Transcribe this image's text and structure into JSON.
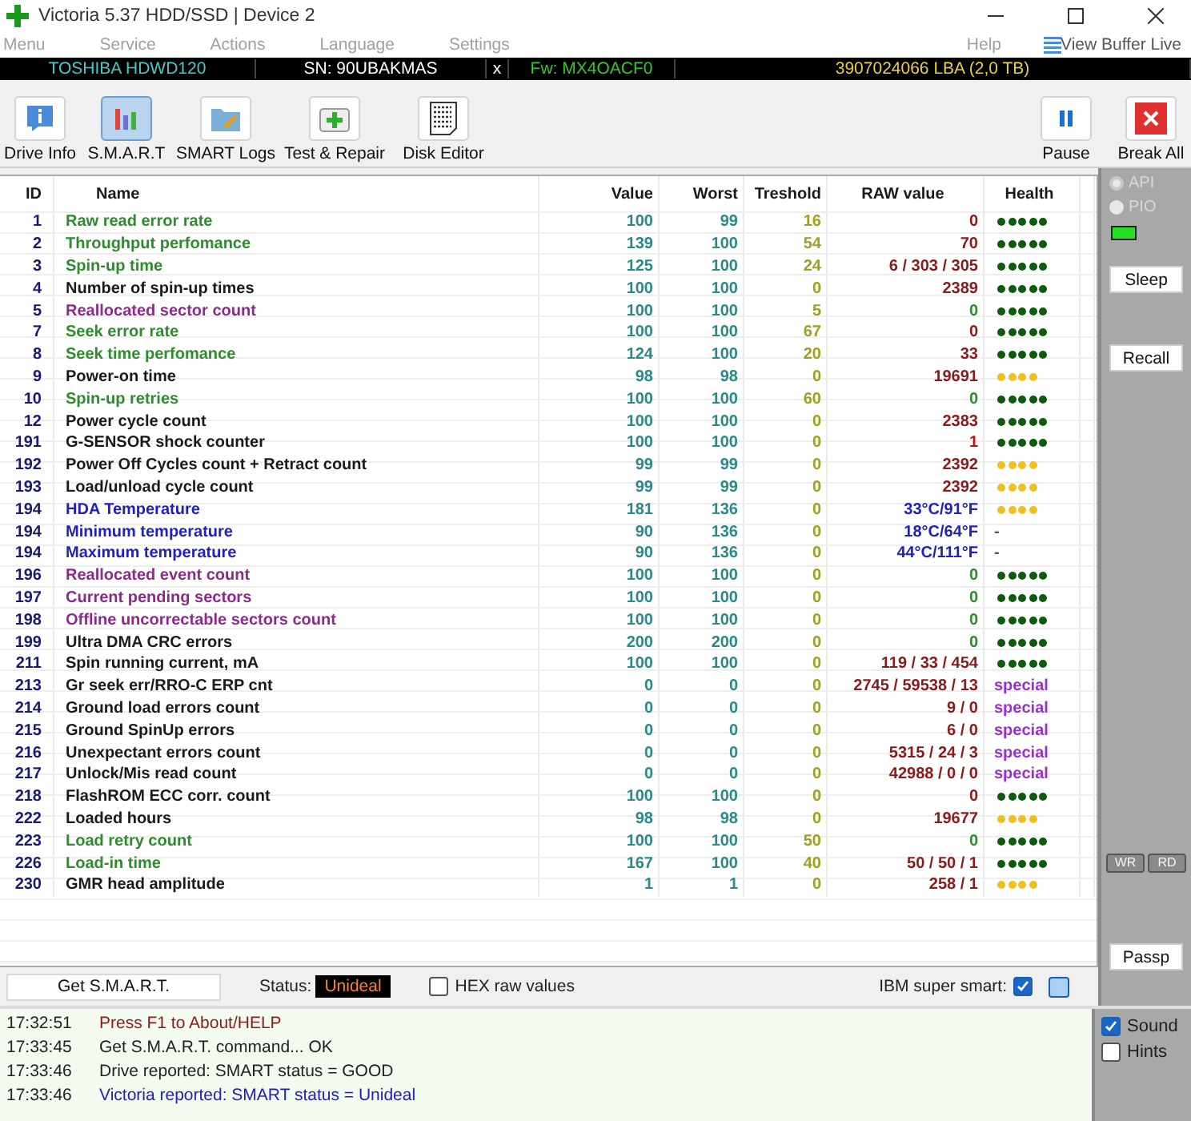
{
  "window": {
    "title": "Victoria 5.37 HDD/SSD | Device 2"
  },
  "menu": [
    {
      "label": "Menu"
    },
    {
      "label": "Service"
    },
    {
      "label": "Actions"
    },
    {
      "label": "Language"
    },
    {
      "label": "Settings"
    }
  ],
  "menu_right": [
    {
      "label": "Help"
    },
    {
      "label": "View Buffer Live"
    }
  ],
  "drive_bar": {
    "model": "TOSHIBA HDWD120",
    "serial": "SN: 90UBAKMAS",
    "close": "x",
    "firmware": "Fw: MX4OACF0",
    "capacity": "3907024066 LBA (2,0 TB)"
  },
  "toolbar": [
    {
      "label": "Drive Info",
      "kind": "info",
      "selected": false
    },
    {
      "label": "S.M.A.R.T",
      "kind": "smart",
      "selected": true
    },
    {
      "label": "SMART Logs",
      "kind": "logs",
      "selected": false
    },
    {
      "label": "Test & Repair",
      "kind": "repair",
      "selected": false
    },
    {
      "label": "Disk Editor",
      "kind": "editor",
      "selected": false
    }
  ],
  "toolbar_right": [
    {
      "label": "Pause",
      "kind": "pause"
    },
    {
      "label": "Break All",
      "kind": "break"
    }
  ],
  "table": {
    "columns": [
      "ID",
      "Name",
      "Value",
      "Worst",
      "Treshold",
      "RAW value",
      "Health"
    ],
    "rows": [
      {
        "id": "1",
        "name": "Raw read error rate",
        "color": "#2e8b2e",
        "value": "100",
        "worst": "99",
        "threshold": "16",
        "raw": {
          "text": "0",
          "color": "#8b1a1a"
        },
        "health": {
          "kind": "dots",
          "stars": 5
        }
      },
      {
        "id": "2",
        "name": "Throughput perfomance",
        "color": "#2e8b2e",
        "value": "139",
        "worst": "100",
        "threshold": "54",
        "raw": {
          "text": "70",
          "color": "#8b1a1a"
        },
        "health": {
          "kind": "dots",
          "stars": 5
        }
      },
      {
        "id": "3",
        "name": "Spin-up time",
        "color": "#2e8b2e",
        "value": "125",
        "worst": "100",
        "threshold": "24",
        "raw": {
          "text": "6 / 303 / 305",
          "color": "#8b1a1a"
        },
        "health": {
          "kind": "dots",
          "stars": 5
        }
      },
      {
        "id": "4",
        "name": "Number of spin-up times",
        "color": "#1a1a1a",
        "value": "100",
        "worst": "100",
        "threshold": "0",
        "raw": {
          "text": "2389",
          "color": "#8b1a1a"
        },
        "health": {
          "kind": "dots",
          "stars": 5
        }
      },
      {
        "id": "5",
        "name": "Reallocated sector count",
        "color": "#8b2a8b",
        "value": "100",
        "worst": "100",
        "threshold": "5",
        "raw": {
          "text": "0",
          "color": "#2e8b2e"
        },
        "health": {
          "kind": "dots",
          "stars": 5
        }
      },
      {
        "id": "7",
        "name": "Seek error rate",
        "color": "#2e8b2e",
        "value": "100",
        "worst": "100",
        "threshold": "67",
        "raw": {
          "text": "0",
          "color": "#8b1a1a"
        },
        "health": {
          "kind": "dots",
          "stars": 5
        }
      },
      {
        "id": "8",
        "name": "Seek time perfomance",
        "color": "#2e8b2e",
        "value": "124",
        "worst": "100",
        "threshold": "20",
        "raw": {
          "text": "33",
          "color": "#8b1a1a"
        },
        "health": {
          "kind": "dots",
          "stars": 5
        }
      },
      {
        "id": "9",
        "name": "Power-on time",
        "color": "#1a1a1a",
        "value": "98",
        "worst": "98",
        "threshold": "0",
        "raw": {
          "text": "19691",
          "color": "#8b1a1a"
        },
        "health": {
          "kind": "dots",
          "stars": 4
        }
      },
      {
        "id": "10",
        "name": "Spin-up retries",
        "color": "#2e8b2e",
        "value": "100",
        "worst": "100",
        "threshold": "60",
        "raw": {
          "text": "0",
          "color": "#2e8b2e"
        },
        "health": {
          "kind": "dots",
          "stars": 5
        }
      },
      {
        "id": "12",
        "name": "Power cycle count",
        "color": "#1a1a1a",
        "value": "100",
        "worst": "100",
        "threshold": "0",
        "raw": {
          "text": "2383",
          "color": "#8b1a1a"
        },
        "health": {
          "kind": "dots",
          "stars": 5
        }
      },
      {
        "id": "191",
        "name": "G-SENSOR shock counter",
        "color": "#1a1a1a",
        "value": "100",
        "worst": "100",
        "threshold": "0",
        "raw": {
          "text": "1",
          "color": "#c01010"
        },
        "health": {
          "kind": "dots",
          "stars": 5
        }
      },
      {
        "id": "192",
        "name": "Power Off Cycles count + Retract count",
        "color": "#1a1a1a",
        "value": "99",
        "worst": "99",
        "threshold": "0",
        "raw": {
          "text": "2392",
          "color": "#8b1a1a"
        },
        "health": {
          "kind": "dots",
          "stars": 4
        }
      },
      {
        "id": "193",
        "name": "Load/unload cycle count",
        "color": "#1a1a1a",
        "value": "99",
        "worst": "99",
        "threshold": "0",
        "raw": {
          "text": "2392",
          "color": "#8b1a1a"
        },
        "health": {
          "kind": "dots",
          "stars": 4
        }
      },
      {
        "id": "194",
        "name": "HDA Temperature",
        "color": "#2020c0",
        "value": "181",
        "worst": "136",
        "threshold": "0",
        "raw": {
          "text": "33°C/91°F",
          "color": "#2020c0"
        },
        "health": {
          "kind": "dots",
          "stars": 4
        }
      },
      {
        "id": "194",
        "name": "Minimum temperature",
        "color": "#2020c0",
        "value": "90",
        "worst": "136",
        "threshold": "0",
        "raw": {
          "text": "18°C/64°F",
          "color": "#2020c0"
        },
        "health": {
          "kind": "label",
          "text": "-",
          "color": "#555555"
        }
      },
      {
        "id": "194",
        "name": "Maximum temperature",
        "color": "#2020c0",
        "value": "90",
        "worst": "136",
        "threshold": "0",
        "raw": {
          "text": "44°C/111°F",
          "color": "#2020c0"
        },
        "health": {
          "kind": "label",
          "text": "-",
          "color": "#555555"
        }
      },
      {
        "id": "196",
        "name": "Reallocated event count",
        "color": "#8b2a8b",
        "value": "100",
        "worst": "100",
        "threshold": "0",
        "raw": {
          "text": "0",
          "color": "#2e8b2e"
        },
        "health": {
          "kind": "dots",
          "stars": 5
        }
      },
      {
        "id": "197",
        "name": "Current pending sectors",
        "color": "#8b2a8b",
        "value": "100",
        "worst": "100",
        "threshold": "0",
        "raw": {
          "text": "0",
          "color": "#2e8b2e"
        },
        "health": {
          "kind": "dots",
          "stars": 5
        }
      },
      {
        "id": "198",
        "name": "Offline uncorrectable sectors count",
        "color": "#8b2a8b",
        "value": "100",
        "worst": "100",
        "threshold": "0",
        "raw": {
          "text": "0",
          "color": "#2e8b2e"
        },
        "health": {
          "kind": "dots",
          "stars": 5
        }
      },
      {
        "id": "199",
        "name": "Ultra DMA CRC errors",
        "color": "#1a1a1a",
        "value": "200",
        "worst": "200",
        "threshold": "0",
        "raw": {
          "text": "0",
          "color": "#2e8b2e"
        },
        "health": {
          "kind": "dots",
          "stars": 5
        }
      },
      {
        "id": "211",
        "name": "Spin running current, mA",
        "color": "#1a1a1a",
        "value": "100",
        "worst": "100",
        "threshold": "0",
        "raw": {
          "text": "119 / 33 / 454",
          "color": "#8b1a1a"
        },
        "health": {
          "kind": "dots",
          "stars": 5
        }
      },
      {
        "id": "213",
        "name": "Gr seek err/RRO-C ERP cnt",
        "color": "#1a1a1a",
        "value": "0",
        "worst": "0",
        "threshold": "0",
        "raw": {
          "text": "2745 / 59538 / 13",
          "color": "#8b1a1a"
        },
        "health": {
          "kind": "label",
          "text": "special",
          "color": "#9a2fd0"
        }
      },
      {
        "id": "214",
        "name": "Ground load errors count",
        "color": "#1a1a1a",
        "value": "0",
        "worst": "0",
        "threshold": "0",
        "raw": {
          "text": "9 / 0",
          "color": "#8b1a1a"
        },
        "health": {
          "kind": "label",
          "text": "special",
          "color": "#9a2fd0"
        }
      },
      {
        "id": "215",
        "name": "Ground SpinUp errors",
        "color": "#1a1a1a",
        "value": "0",
        "worst": "0",
        "threshold": "0",
        "raw": {
          "text": "6 / 0",
          "color": "#8b1a1a"
        },
        "health": {
          "kind": "label",
          "text": "special",
          "color": "#9a2fd0"
        }
      },
      {
        "id": "216",
        "name": "Unexpectant errors count",
        "color": "#1a1a1a",
        "value": "0",
        "worst": "0",
        "threshold": "0",
        "raw": {
          "text": "5315 / 24 / 3",
          "color": "#8b1a1a"
        },
        "health": {
          "kind": "label",
          "text": "special",
          "color": "#9a2fd0"
        }
      },
      {
        "id": "217",
        "name": "Unlock/Mis read count",
        "color": "#1a1a1a",
        "value": "0",
        "worst": "0",
        "threshold": "0",
        "raw": {
          "text": "42988 / 0 / 0",
          "color": "#8b1a1a"
        },
        "health": {
          "kind": "label",
          "text": "special",
          "color": "#9a2fd0"
        }
      },
      {
        "id": "218",
        "name": "FlashROM ECC corr. count",
        "color": "#1a1a1a",
        "value": "100",
        "worst": "100",
        "threshold": "0",
        "raw": {
          "text": "0",
          "color": "#8b1a1a"
        },
        "health": {
          "kind": "dots",
          "stars": 5
        }
      },
      {
        "id": "222",
        "name": "Loaded hours",
        "color": "#1a1a1a",
        "value": "98",
        "worst": "98",
        "threshold": "0",
        "raw": {
          "text": "19677",
          "color": "#8b1a1a"
        },
        "health": {
          "kind": "dots",
          "stars": 4
        }
      },
      {
        "id": "223",
        "name": "Load retry count",
        "color": "#2e8b2e",
        "value": "100",
        "worst": "100",
        "threshold": "50",
        "raw": {
          "text": "0",
          "color": "#2e8b2e"
        },
        "health": {
          "kind": "dots",
          "stars": 5
        }
      },
      {
        "id": "226",
        "name": "Load-in time",
        "color": "#2e8b2e",
        "value": "167",
        "worst": "100",
        "threshold": "40",
        "raw": {
          "text": "50 / 50 / 1",
          "color": "#8b1a1a"
        },
        "health": {
          "kind": "dots",
          "stars": 5
        }
      },
      {
        "id": "230",
        "name": "GMR head amplitude",
        "color": "#1a1a1a",
        "value": "1",
        "worst": "1",
        "threshold": "0",
        "raw": {
          "text": "258 / 1",
          "color": "#8b1a1a"
        },
        "health": {
          "kind": "dots",
          "stars": 4
        }
      }
    ]
  },
  "side_panel": {
    "radios": [
      {
        "label": "API",
        "selected": true
      },
      {
        "label": "PIO",
        "selected": false
      }
    ],
    "led_on": true,
    "buttons": [
      {
        "label": "Sleep"
      },
      {
        "label": "Recall"
      }
    ],
    "small_buttons": [
      {
        "label": "WR"
      },
      {
        "label": "RD"
      }
    ],
    "bottom_button": {
      "label": "Passp"
    }
  },
  "bottom_bar": {
    "button": "Get S.M.A.R.T.",
    "status_label": "Status:",
    "status": "Unideal",
    "hex_raw": {
      "label": "HEX raw values",
      "checked": false
    },
    "ibm": {
      "label": "IBM super smart:",
      "checked": true
    },
    "extra_checked": false
  },
  "log": [
    {
      "time": "17:32:51",
      "text": "Press F1 to About/HELP",
      "color": "#8b1a1a"
    },
    {
      "time": "17:33:45",
      "text": "Get S.M.A.R.T. command... OK",
      "color": "#222222"
    },
    {
      "time": "17:33:46",
      "text": "Drive reported: SMART status = GOOD",
      "color": "#222222"
    },
    {
      "time": "17:33:46",
      "text": "Victoria reported: SMART status = Unideal",
      "color": "#2020c0"
    }
  ],
  "log_options": [
    {
      "label": "Sound",
      "checked": true
    },
    {
      "label": "Hints",
      "checked": false
    }
  ]
}
